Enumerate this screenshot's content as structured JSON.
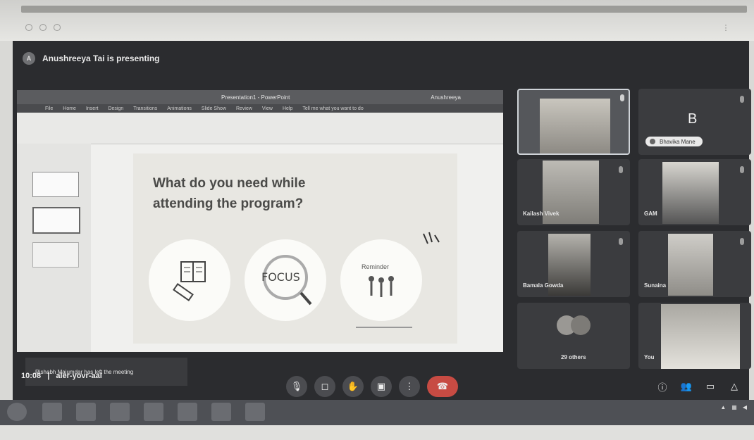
{
  "meeting": {
    "presenter_text": "Anushreeya Tai is presenting",
    "time_text": "10:08",
    "meeting_code": "aler-yovr-aal"
  },
  "ppt": {
    "window_title": "Presentation1 - PowerPoint",
    "account": "Anushreeya",
    "ribbon_tabs": [
      "File",
      "Home",
      "Insert",
      "Design",
      "Transitions",
      "Animations",
      "Slide Show",
      "Review",
      "View",
      "Help"
    ],
    "search": "Tell me what you want to do"
  },
  "slide": {
    "title_line1": "What do you need while",
    "title_line2": "attending the program?",
    "focus_label": "FOCUS",
    "reminder_label": "Reminder"
  },
  "toast": {
    "text": "Rishabh Majumdar has left the meeting"
  },
  "participants": [
    {
      "name": "",
      "type": "video"
    },
    {
      "name": "Bhavika Mane",
      "type": "letter",
      "letter": "B"
    },
    {
      "name": "Kailash Vivek",
      "type": "video"
    },
    {
      "name": "GAM",
      "type": "video"
    },
    {
      "name": "Bamala Gowda",
      "type": "video"
    },
    {
      "name": "Sunaina",
      "type": "video"
    },
    {
      "name": "29 others",
      "type": "group"
    },
    {
      "name": "You",
      "type": "video"
    }
  ],
  "icons": {
    "mic": "mic-icon",
    "camera": "camera-icon",
    "hand": "raise-hand-icon",
    "present": "present-icon",
    "more": "more-icon",
    "hangup": "end-call-icon",
    "info": "info-icon",
    "people": "people-icon",
    "chat": "chat-icon",
    "activities": "activities-icon"
  },
  "colors": {
    "meet_bg": "#2b2c2f",
    "hangup": "#c74b43"
  }
}
